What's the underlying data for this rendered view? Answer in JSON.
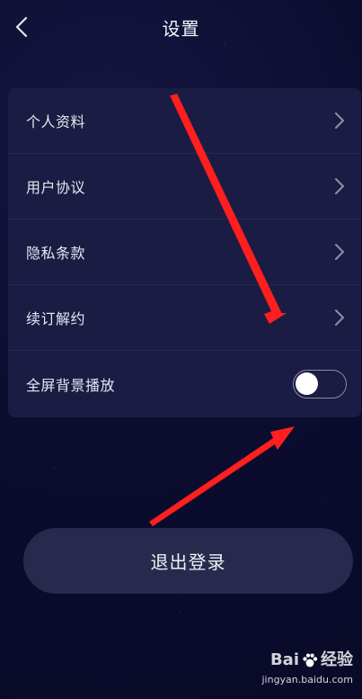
{
  "header": {
    "title": "设置"
  },
  "settings": {
    "items": [
      {
        "label": "个人资料",
        "type": "link"
      },
      {
        "label": "用户协议",
        "type": "link"
      },
      {
        "label": "隐私条款",
        "type": "link"
      },
      {
        "label": "续订解约",
        "type": "link"
      },
      {
        "label": "全屏背景播放",
        "type": "toggle",
        "on": false
      }
    ]
  },
  "logout": {
    "label": "退出登录"
  },
  "icons": {
    "back": "chevron-left-icon",
    "row_arrow": "chevron-right-icon",
    "annotation": "red-arrow-icon"
  },
  "colors": {
    "background": "#0c0d2f",
    "card": "#1b1c43",
    "button": "#282a4d",
    "annotation_red": "#ff1f1f"
  },
  "watermark": {
    "brand_left": "Bai",
    "brand_right": "经验",
    "url": "jingyan.baidu.com"
  }
}
